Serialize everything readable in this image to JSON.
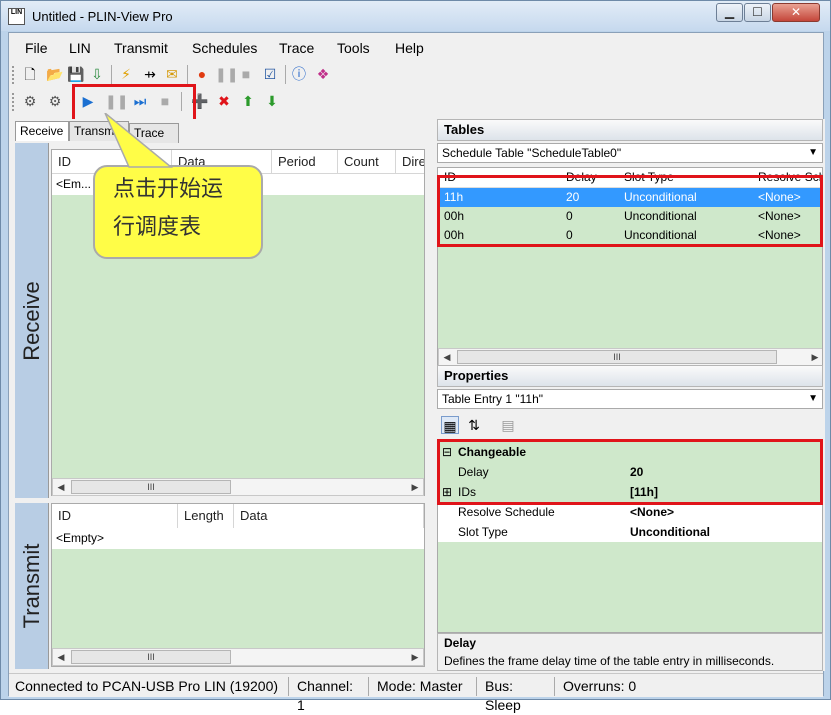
{
  "window": {
    "title": "Untitled - PLIN-View Pro",
    "icon_text": "LIN",
    "min": "▁",
    "max": "☐",
    "close": "✕"
  },
  "menu": [
    "File",
    "LIN",
    "Transmit",
    "Schedules",
    "Trace",
    "Tools",
    "Help"
  ],
  "toolbar1_icons": [
    "new-icon",
    "open-icon",
    "save-icon",
    "save-as-icon",
    "connect-icon",
    "disconnect-icon",
    "folder-icon",
    "record-icon",
    "pause-icon",
    "stop-icon",
    "checklist-icon",
    "info-icon",
    "help-book-icon"
  ],
  "toolbar2_icons": [
    "config-icon",
    "config2-icon",
    "play-icon",
    "pause-icon",
    "step-icon",
    "stop-icon",
    "add-icon",
    "delete-icon",
    "up-icon",
    "down-icon"
  ],
  "receive": {
    "tabs": [
      "Receive",
      "Transmit",
      "Trace"
    ],
    "side_label": "Receive",
    "columns": [
      "ID",
      "Data",
      "Period",
      "Count",
      "Dire"
    ],
    "empty": "<Em...",
    "scroll_mid": "III"
  },
  "callout": {
    "line1": "点击开始运",
    "line2": "行调度表"
  },
  "transmit": {
    "side_label": "Transmit",
    "columns": [
      "ID",
      "Length",
      "Data"
    ],
    "empty": "<Empty>",
    "scroll_mid": "III"
  },
  "tables": {
    "title": "Tables",
    "selected_table": "Schedule Table \"ScheduleTable0\"",
    "columns": [
      "ID",
      "Delay",
      "Slot Type",
      "Resolve Sch"
    ],
    "rows": [
      {
        "id": "11h",
        "delay": "20",
        "slot": "Unconditional",
        "resolve": "<None>"
      },
      {
        "id": "00h",
        "delay": "0",
        "slot": "Unconditional",
        "resolve": "<None>"
      },
      {
        "id": "00h",
        "delay": "0",
        "slot": "Unconditional",
        "resolve": "<None>"
      }
    ],
    "scroll_mid": "III"
  },
  "properties": {
    "title": "Properties",
    "selected_entry": "Table Entry 1 \"11h\"",
    "category": "Changeable",
    "rows": [
      {
        "name": "Delay",
        "value": "20"
      },
      {
        "name": "IDs",
        "value": "[11h]"
      },
      {
        "name": "Resolve Schedule",
        "value": "<None>"
      },
      {
        "name": "Slot Type",
        "value": "Unconditional"
      }
    ],
    "desc_title": "Delay",
    "desc_text": "Defines the frame delay time of the table entry in milliseconds."
  },
  "status": {
    "connection": "Connected to PCAN-USB Pro LIN (19200)",
    "channel": "Channel: 1",
    "mode": "Mode: Master",
    "bus": "Bus: Sleep",
    "overruns": "Overruns: 0"
  },
  "colors": {
    "grid": "#cfe8cb",
    "selection": "#3399ff",
    "highlight": "#e0141a",
    "callout": "#fffd47"
  }
}
